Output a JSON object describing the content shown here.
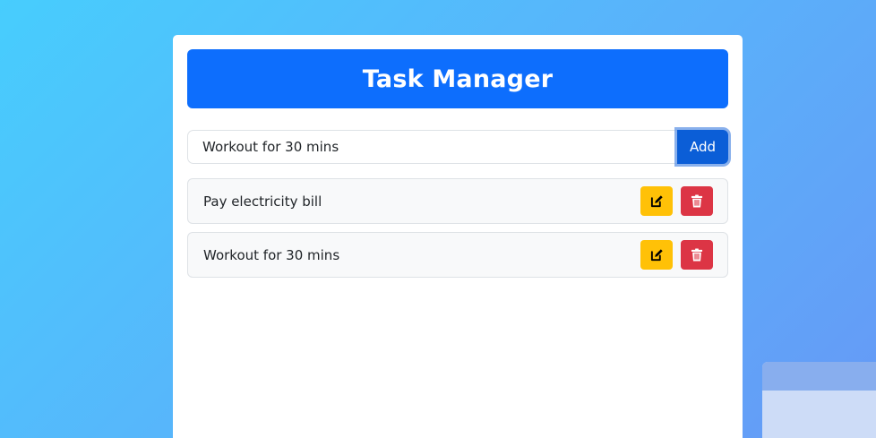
{
  "app": {
    "title": "Task Manager"
  },
  "input": {
    "value": "Workout for 30 mins",
    "add_label": "Add"
  },
  "tasks": [
    {
      "text": "Pay electricity bill",
      "edit_icon": "edit-icon",
      "delete_icon": "trash-icon"
    },
    {
      "text": "Workout for 30 mins",
      "edit_icon": "edit-icon",
      "delete_icon": "trash-icon"
    }
  ],
  "colors": {
    "primary": "#0d6efd",
    "warning": "#ffc107",
    "danger": "#dc3545"
  }
}
